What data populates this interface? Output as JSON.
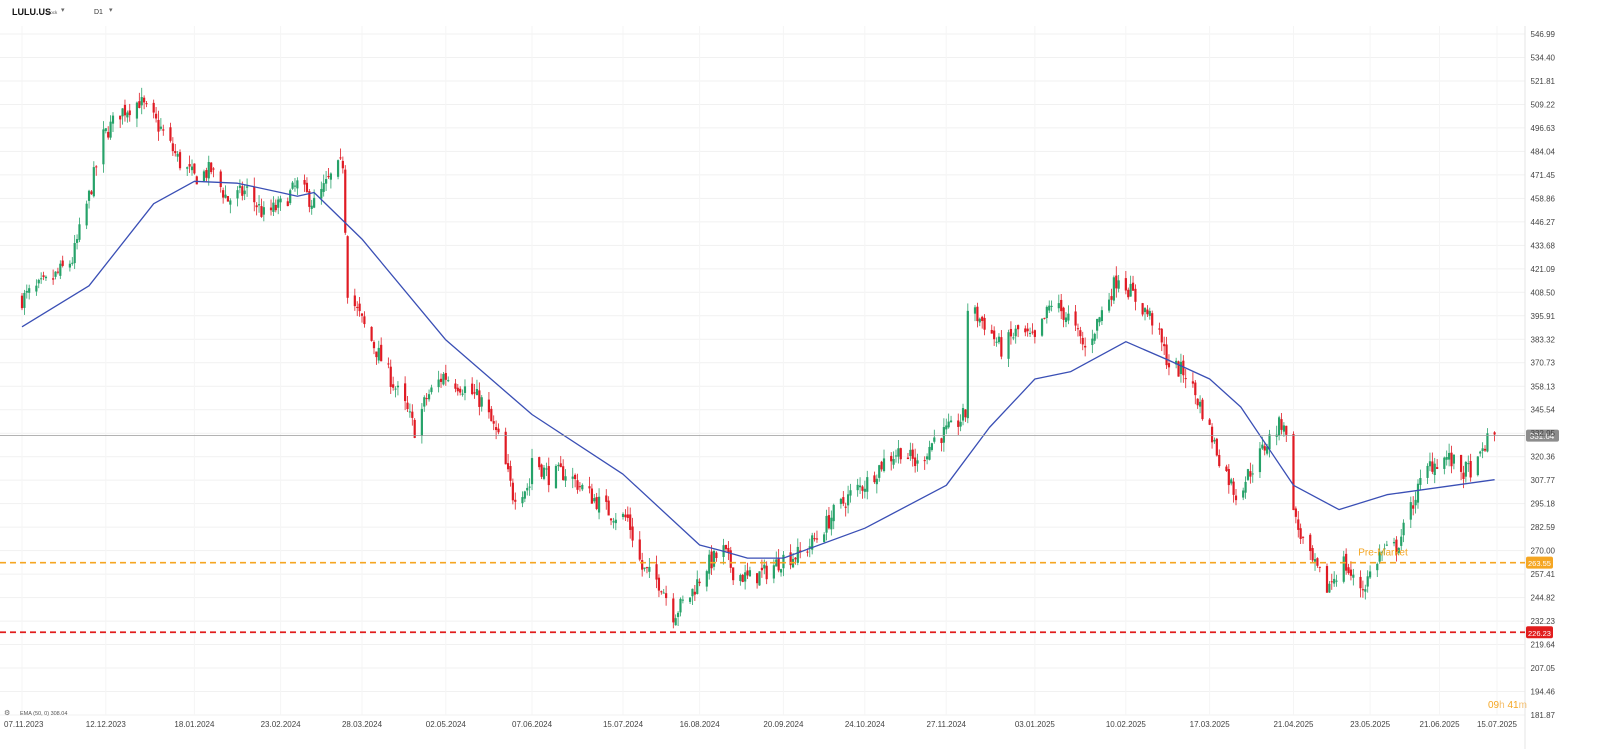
{
  "header": {
    "symbol": "LULU.US",
    "symbol_type": "Stock",
    "timeframe": "D1"
  },
  "indicator": {
    "label": "EMA (50, 0) 308.04"
  },
  "countdown": {
    "hours": "09",
    "h_unit": "h",
    "minutes": "41",
    "m_unit": "m"
  },
  "colors": {
    "up": "#26a269",
    "down": "#e01b24",
    "ema": "#3a4fb5",
    "premarket": "#f5a623",
    "support": "#e11d1d",
    "last_price_tag": "#8c8c8c"
  },
  "chart_data": {
    "type": "candlestick",
    "y_ticks": [
      "546.99",
      "534.40",
      "521.81",
      "509.22",
      "496.63",
      "484.04",
      "471.45",
      "458.86",
      "446.27",
      "433.68",
      "421.09",
      "408.50",
      "395.91",
      "383.32",
      "370.73",
      "358.13",
      "345.54",
      "332.95",
      "320.36",
      "307.77",
      "295.18",
      "282.59",
      "270.00",
      "257.41",
      "244.82",
      "232.23",
      "219.64",
      "207.05",
      "194.46",
      "181.87"
    ],
    "ylim": [
      181.87,
      546.99
    ],
    "x_labels": [
      "07.11.2023",
      "12.12.2023",
      "18.01.2024",
      "23.02.2024",
      "28.03.2024",
      "02.05.2024",
      "07.06.2024",
      "15.07.2024",
      "16.08.2024",
      "20.09.2024",
      "24.10.2024",
      "27.11.2024",
      "03.01.2025",
      "10.02.2025",
      "17.03.2025",
      "21.04.2025",
      "23.05.2025",
      "21.06.2025",
      "15.07.2025"
    ],
    "price_path": [
      [
        "07.11.2023",
        405
      ],
      [
        "20.11.2023",
        416
      ],
      [
        "28.11.2023",
        426
      ],
      [
        "05.12.2023",
        460
      ],
      [
        "11.12.2023",
        492
      ],
      [
        "18.12.2023",
        505
      ],
      [
        "26.12.2023",
        511
      ],
      [
        "04.01.2024",
        496
      ],
      [
        "12.01.2024",
        478
      ],
      [
        "18.01.2024",
        470
      ],
      [
        "25.01.2024",
        474
      ],
      [
        "01.02.2024",
        458
      ],
      [
        "09.02.2024",
        463
      ],
      [
        "16.02.2024",
        450
      ],
      [
        "23.02.2024",
        455
      ],
      [
        "01.03.2024",
        466
      ],
      [
        "08.03.2024",
        456
      ],
      [
        "15.03.2024",
        470
      ],
      [
        "20.03.2024",
        478
      ],
      [
        "22.03.2024",
        410
      ],
      [
        "29.03.2024",
        390
      ],
      [
        "08.04.2024",
        365
      ],
      [
        "15.04.2024",
        347
      ],
      [
        "19.04.2024",
        335
      ],
      [
        "24.04.2024",
        352
      ],
      [
        "01.05.2024",
        364
      ],
      [
        "09.05.2024",
        358
      ],
      [
        "17.05.2024",
        350
      ],
      [
        "24.05.2024",
        330
      ],
      [
        "30.05.2024",
        300
      ],
      [
        "06.06.2024",
        305
      ],
      [
        "07.06.2024",
        320
      ],
      [
        "14.06.2024",
        310
      ],
      [
        "21.06.2024",
        312
      ],
      [
        "01.07.2024",
        300
      ],
      [
        "10.07.2024",
        290
      ],
      [
        "17.07.2024",
        287
      ],
      [
        "23.07.2024",
        260
      ],
      [
        "31.07.2024",
        252
      ],
      [
        "05.08.2024",
        236
      ],
      [
        "12.08.2024",
        246
      ],
      [
        "19.08.2024",
        262
      ],
      [
        "26.08.2024",
        270
      ],
      [
        "30.08.2024",
        259
      ],
      [
        "05.09.2024",
        255
      ],
      [
        "12.09.2024",
        258
      ],
      [
        "20.09.2024",
        266
      ],
      [
        "27.09.2024",
        268
      ],
      [
        "04.10.2024",
        277
      ],
      [
        "11.10.2024",
        290
      ],
      [
        "18.10.2024",
        300
      ],
      [
        "25.10.2024",
        307
      ],
      [
        "01.11.2024",
        318
      ],
      [
        "08.11.2024",
        324
      ],
      [
        "15.11.2024",
        316
      ],
      [
        "22.11.2024",
        330
      ],
      [
        "29.11.2024",
        335
      ],
      [
        "05.12.2024",
        343
      ],
      [
        "06.12.2024",
        400
      ],
      [
        "13.12.2024",
        392
      ],
      [
        "20.12.2024",
        378
      ],
      [
        "27.12.2024",
        388
      ],
      [
        "03.01.2025",
        382
      ],
      [
        "10.01.2025",
        403
      ],
      [
        "17.01.2025",
        395
      ],
      [
        "24.01.2025",
        378
      ],
      [
        "31.01.2025",
        398
      ],
      [
        "07.02.2025",
        418
      ],
      [
        "14.02.2025",
        405
      ],
      [
        "21.02.2025",
        394
      ],
      [
        "28.02.2025",
        370
      ],
      [
        "07.03.2025",
        365
      ],
      [
        "14.03.2025",
        345
      ],
      [
        "21.03.2025",
        320
      ],
      [
        "28.03.2025",
        300
      ],
      [
        "04.04.2025",
        315
      ],
      [
        "11.04.2025",
        330
      ],
      [
        "17.04.2025",
        340
      ],
      [
        "22.04.2025",
        285
      ],
      [
        "28.04.2025",
        265
      ],
      [
        "05.05.2025",
        250
      ],
      [
        "12.05.2025",
        264
      ],
      [
        "16.05.2025",
        254
      ],
      [
        "20.05.2025",
        250
      ],
      [
        "27.05.2025",
        268
      ],
      [
        "03.06.2025",
        272
      ],
      [
        "06.06.2025",
        281
      ],
      [
        "11.06.2025",
        300
      ],
      [
        "17.06.2025",
        316
      ],
      [
        "24.06.2025",
        320
      ],
      [
        "01.07.2025",
        312
      ],
      [
        "07.07.2025",
        316
      ],
      [
        "10.07.2025",
        327
      ],
      [
        "14.07.2025",
        332
      ]
    ],
    "ema_path": [
      [
        "07.11.2023",
        390
      ],
      [
        "05.12.2023",
        412
      ],
      [
        "01.01.2024",
        456
      ],
      [
        "18.01.2024",
        468
      ],
      [
        "05.02.2024",
        467
      ],
      [
        "23.02.2024",
        462
      ],
      [
        "01.03.2024",
        460
      ],
      [
        "08.03.2024",
        462
      ],
      [
        "28.03.2024",
        437
      ],
      [
        "02.05.2024",
        383
      ],
      [
        "07.06.2024",
        343
      ],
      [
        "15.07.2024",
        311
      ],
      [
        "16.08.2024",
        273
      ],
      [
        "25.08.2024",
        270
      ],
      [
        "05.09.2024",
        266
      ],
      [
        "20.09.2024",
        266
      ],
      [
        "24.10.2024",
        282
      ],
      [
        "27.11.2024",
        305
      ],
      [
        "15.12.2024",
        336
      ],
      [
        "03.01.2025",
        362
      ],
      [
        "18.01.2025",
        366
      ],
      [
        "10.02.2025",
        382
      ],
      [
        "28.02.2025",
        372
      ],
      [
        "17.03.2025",
        362
      ],
      [
        "30.03.2025",
        347
      ],
      [
        "21.04.2025",
        305
      ],
      [
        "10.05.2025",
        292
      ],
      [
        "30.05.2025",
        300
      ],
      [
        "14.07.2025",
        308
      ]
    ],
    "last_price": 331.64,
    "premarket_price": 263.55,
    "premarket_label": "Pre-Market",
    "support_price": 226.23,
    "grid": true,
    "legend": "none"
  }
}
